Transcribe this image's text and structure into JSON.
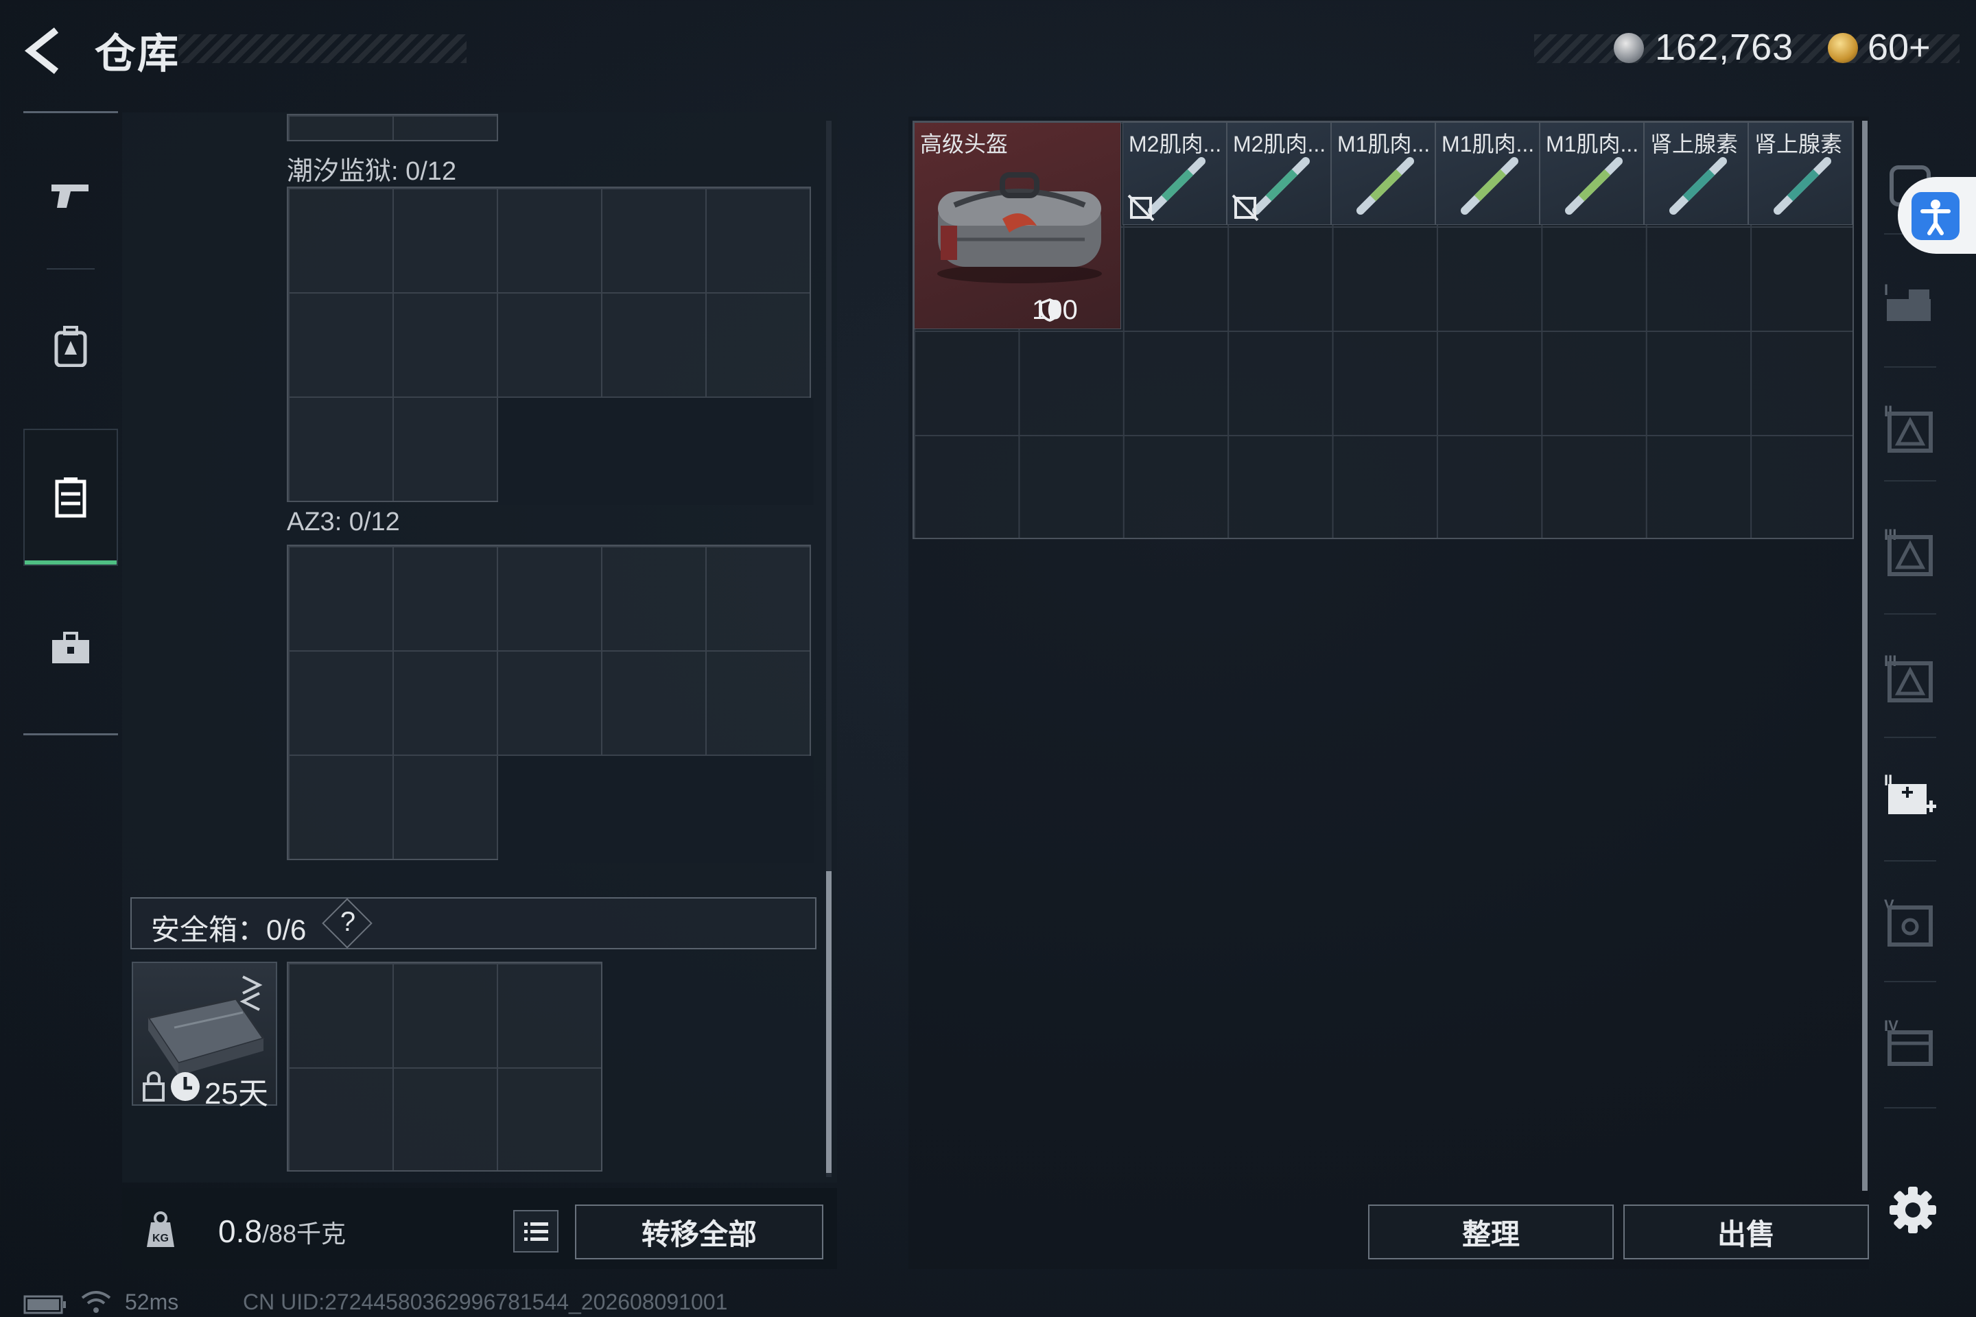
{
  "header": {
    "title": "仓库",
    "currency_primary": "162,763",
    "currency_secondary": "60+"
  },
  "left_nav": {
    "items": [
      {
        "name": "weapons",
        "icon": "pistol-icon"
      },
      {
        "name": "gear",
        "icon": "backpack-icon"
      },
      {
        "name": "containers",
        "icon": "vest-icon",
        "active": true
      },
      {
        "name": "supplies",
        "icon": "toolbox-icon"
      }
    ]
  },
  "containers": {
    "section1_label": "潮汐监狱: 0/12",
    "section2_label": "AZ3: 0/12",
    "safe_box_label": "安全箱：0/6",
    "safe_box_help": "?",
    "safe_box_duration": "25天"
  },
  "bottom_left": {
    "weight_value": "0.8",
    "weight_capacity": "/88千克",
    "transfer_all": "转移全部"
  },
  "stash": {
    "items": [
      {
        "name": "高级头盔",
        "armor": "100"
      },
      {
        "name": "M2肌肉...",
        "disabled": true
      },
      {
        "name": "M2肌肉...",
        "disabled": true
      },
      {
        "name": "M1肌肉..."
      },
      {
        "name": "M1肌肉..."
      },
      {
        "name": "M1肌肉..."
      },
      {
        "name": "肾上腺素"
      },
      {
        "name": "肾上腺素"
      }
    ],
    "sort_button": "整理",
    "sell_button": "出售"
  },
  "right_tabs": [
    "I",
    "II",
    "III",
    "IV",
    "V"
  ],
  "status_bar": {
    "ping": "52ms",
    "uid": "CN UID:272445803629967815​44_202608091001"
  },
  "colors": {
    "accent": "#4fbf83",
    "helmet_bg": "#5a2b2f",
    "accessibility": "#2f7ee8"
  }
}
